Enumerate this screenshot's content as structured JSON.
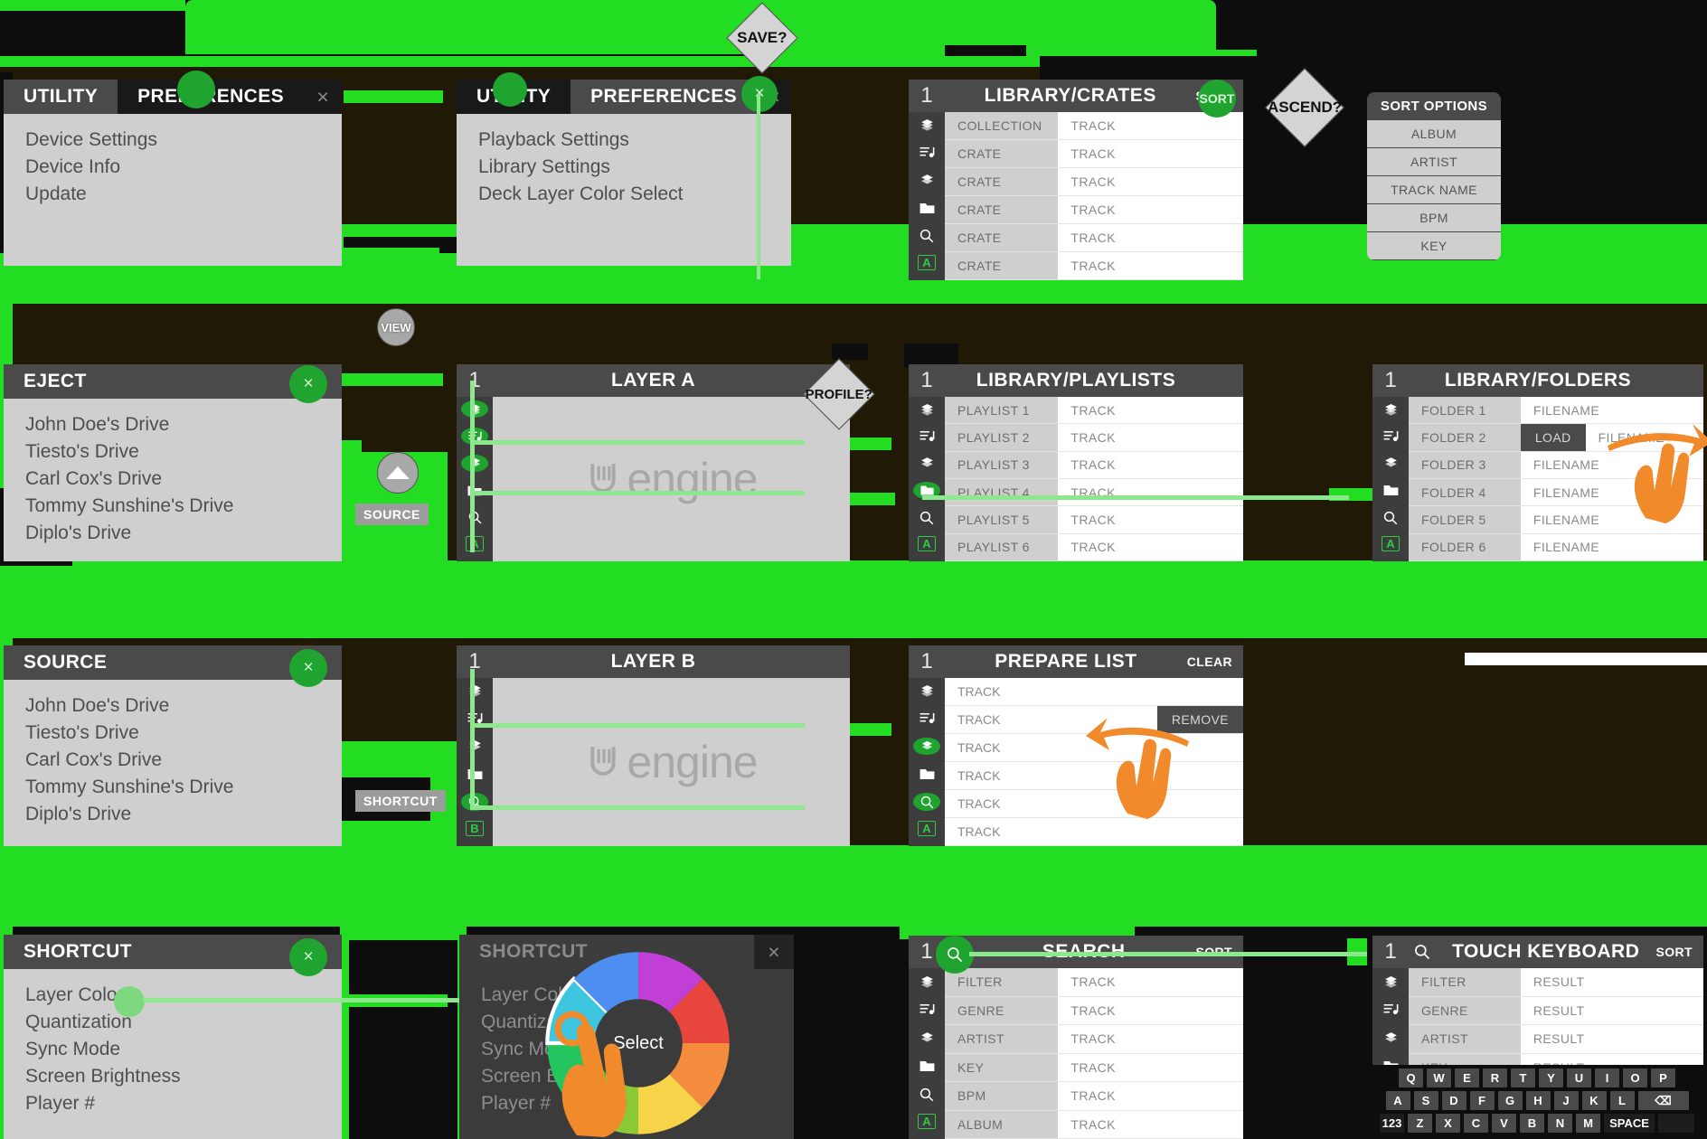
{
  "theme": {
    "accent_green": "#22dd22",
    "button_green": "#1fa52f",
    "panel_grey": "#cfcfcf",
    "header_grey": "#4a4a4a",
    "dark_bg": "#1c1605",
    "touch_orange": "#f18a2b"
  },
  "flow_nodes": {
    "save": "SAVE?",
    "ascend": "ASCEND?",
    "profile": "PROFILE?",
    "view": "VIEW",
    "source_tag": "SOURCE",
    "shortcut_tag": "SHORTCUT",
    "close_glyph": "×"
  },
  "utility_prefs_1": {
    "tabs": [
      {
        "label": "UTILITY",
        "active": true
      },
      {
        "label": "PREFERENCES",
        "active": false
      }
    ],
    "options": [
      "Device Settings",
      "Device Info",
      "Update"
    ]
  },
  "utility_prefs_2": {
    "tabs": [
      {
        "label": "UTILITY",
        "active": false
      },
      {
        "label": "PREFERENCES",
        "active": true
      }
    ],
    "options": [
      "Playback Settings",
      "Library Settings",
      "Deck Layer Color Select"
    ]
  },
  "library_crates": {
    "number": "1",
    "title": "LIBRARY/CRATES",
    "action": "SORT",
    "rail_icons": [
      "crate-stack-icon",
      "playlist-note-icon",
      "crate-icon",
      "folder-icon",
      "search-icon",
      "layer-a-icon"
    ],
    "rows": [
      {
        "left": "COLLECTION",
        "right": "TRACK"
      },
      {
        "left": "CRATE",
        "right": "TRACK"
      },
      {
        "left": "CRATE",
        "right": "TRACK"
      },
      {
        "left": "CRATE",
        "right": "TRACK"
      },
      {
        "left": "CRATE",
        "right": "TRACK"
      },
      {
        "left": "CRATE",
        "right": "TRACK"
      }
    ]
  },
  "sort_options": {
    "title": "SORT OPTIONS",
    "items": [
      "ALBUM",
      "ARTIST",
      "TRACK NAME",
      "BPM",
      "KEY"
    ]
  },
  "eject": {
    "title": "EJECT",
    "drives": [
      "John Doe's Drive",
      "Tiesto's Drive",
      "Carl Cox's Drive",
      "Tommy Sunshine's Drive",
      "Diplo's Drive"
    ]
  },
  "source": {
    "title": "SOURCE",
    "drives": [
      "John Doe's Drive",
      "Tiesto's Drive",
      "Carl Cox's Drive",
      "Tommy Sunshine's Drive",
      "Diplo's Drive"
    ]
  },
  "layer_a": {
    "number": "1",
    "title": "LAYER A",
    "logo_text": "engine",
    "rail_icons": [
      "crate-stack-icon",
      "playlist-note-icon",
      "crate-icon",
      "folder-icon",
      "search-icon",
      "layer-a-icon"
    ]
  },
  "layer_b": {
    "number": "1",
    "title": "LAYER B",
    "logo_text": "engine",
    "rail_icons": [
      "crate-stack-icon",
      "playlist-note-icon",
      "crate-icon",
      "folder-icon",
      "search-icon",
      "layer-b-icon"
    ]
  },
  "library_playlists": {
    "number": "1",
    "title": "LIBRARY/PLAYLISTS",
    "rows": [
      {
        "left": "PLAYLIST 1",
        "right": "TRACK"
      },
      {
        "left": "PLAYLIST 2",
        "right": "TRACK"
      },
      {
        "left": "PLAYLIST 3",
        "right": "TRACK"
      },
      {
        "left": "PLAYLIST 4",
        "right": "TRACK"
      },
      {
        "left": "PLAYLIST 5",
        "right": "TRACK"
      },
      {
        "left": "PLAYLIST 6",
        "right": "TRACK"
      }
    ]
  },
  "library_folders": {
    "number": "1",
    "title": "LIBRARY/FOLDERS",
    "load_label": "LOAD",
    "rows": [
      {
        "left": "FOLDER 1",
        "right": "FILENAME",
        "load": false
      },
      {
        "left": "FOLDER 2",
        "right": "FILENAME",
        "load": true
      },
      {
        "left": "FOLDER 3",
        "right": "FILENAME",
        "load": false
      },
      {
        "left": "FOLDER 4",
        "right": "FILENAME",
        "load": false
      },
      {
        "left": "FOLDER 5",
        "right": "FILENAME",
        "load": false
      },
      {
        "left": "FOLDER 6",
        "right": "FILENAME",
        "load": false
      }
    ],
    "gesture": "swipe-right-hand-icon"
  },
  "prepare_list": {
    "number": "1",
    "title": "PREPARE LIST",
    "action": "CLEAR",
    "remove_label": "REMOVE",
    "rows": [
      "TRACK",
      "TRACK",
      "TRACK",
      "TRACK",
      "TRACK",
      "TRACK"
    ],
    "gesture": "swipe-left-hand-icon"
  },
  "shortcut": {
    "title": "SHORTCUT",
    "options": [
      "Layer Color",
      "Quantization",
      "Sync Mode",
      "Screen Brightness",
      "Player #"
    ]
  },
  "shortcut_modal": {
    "title": "SHORTCUT",
    "options": [
      "Layer Color",
      "Quantization",
      "Sync Mode",
      "Screen Brightness",
      "Player #"
    ],
    "wheel": {
      "hub_label": "Select",
      "selected_index": 5,
      "segments": [
        {
          "name": "magenta",
          "color": "#c13fd6"
        },
        {
          "name": "red",
          "color": "#e8453c"
        },
        {
          "name": "orange",
          "color": "#f58b3c"
        },
        {
          "name": "yellow",
          "color": "#f7d34a"
        },
        {
          "name": "lime",
          "color": "#8bc936"
        },
        {
          "name": "green",
          "color": "#22c55e"
        },
        {
          "name": "cyan",
          "color": "#3ec6e0"
        },
        {
          "name": "blue",
          "color": "#4d8ef0"
        }
      ]
    },
    "gesture": "tap-hand-icon"
  },
  "search": {
    "number": "1",
    "title": "SEARCH",
    "action": "SORT",
    "rows": [
      {
        "left": "FILTER",
        "right": "TRACK"
      },
      {
        "left": "GENRE",
        "right": "TRACK"
      },
      {
        "left": "ARTIST",
        "right": "TRACK"
      },
      {
        "left": "KEY",
        "right": "TRACK"
      },
      {
        "left": "BPM",
        "right": "TRACK"
      },
      {
        "left": "ALBUM",
        "right": "TRACK"
      }
    ]
  },
  "touch_keyboard": {
    "number": "1",
    "title": "TOUCH KEYBOARD",
    "action": "SORT",
    "rows": [
      {
        "left": "FILTER",
        "right": "RESULT"
      },
      {
        "left": "GENRE",
        "right": "RESULT"
      },
      {
        "left": "ARTIST",
        "right": "RESULT"
      },
      {
        "left": "KEY",
        "right": "RESULT"
      }
    ],
    "keyboard": {
      "row1": [
        "Q",
        "W",
        "E",
        "R",
        "T",
        "Y",
        "U",
        "I",
        "O",
        "P"
      ],
      "row2": [
        "A",
        "S",
        "D",
        "F",
        "G",
        "H",
        "J",
        "K",
        "L"
      ],
      "backspace": "⌫",
      "numeric": "123",
      "row3": [
        "Z",
        "X",
        "C",
        "V",
        "B",
        "N",
        "M"
      ],
      "space": "SPACE"
    }
  }
}
